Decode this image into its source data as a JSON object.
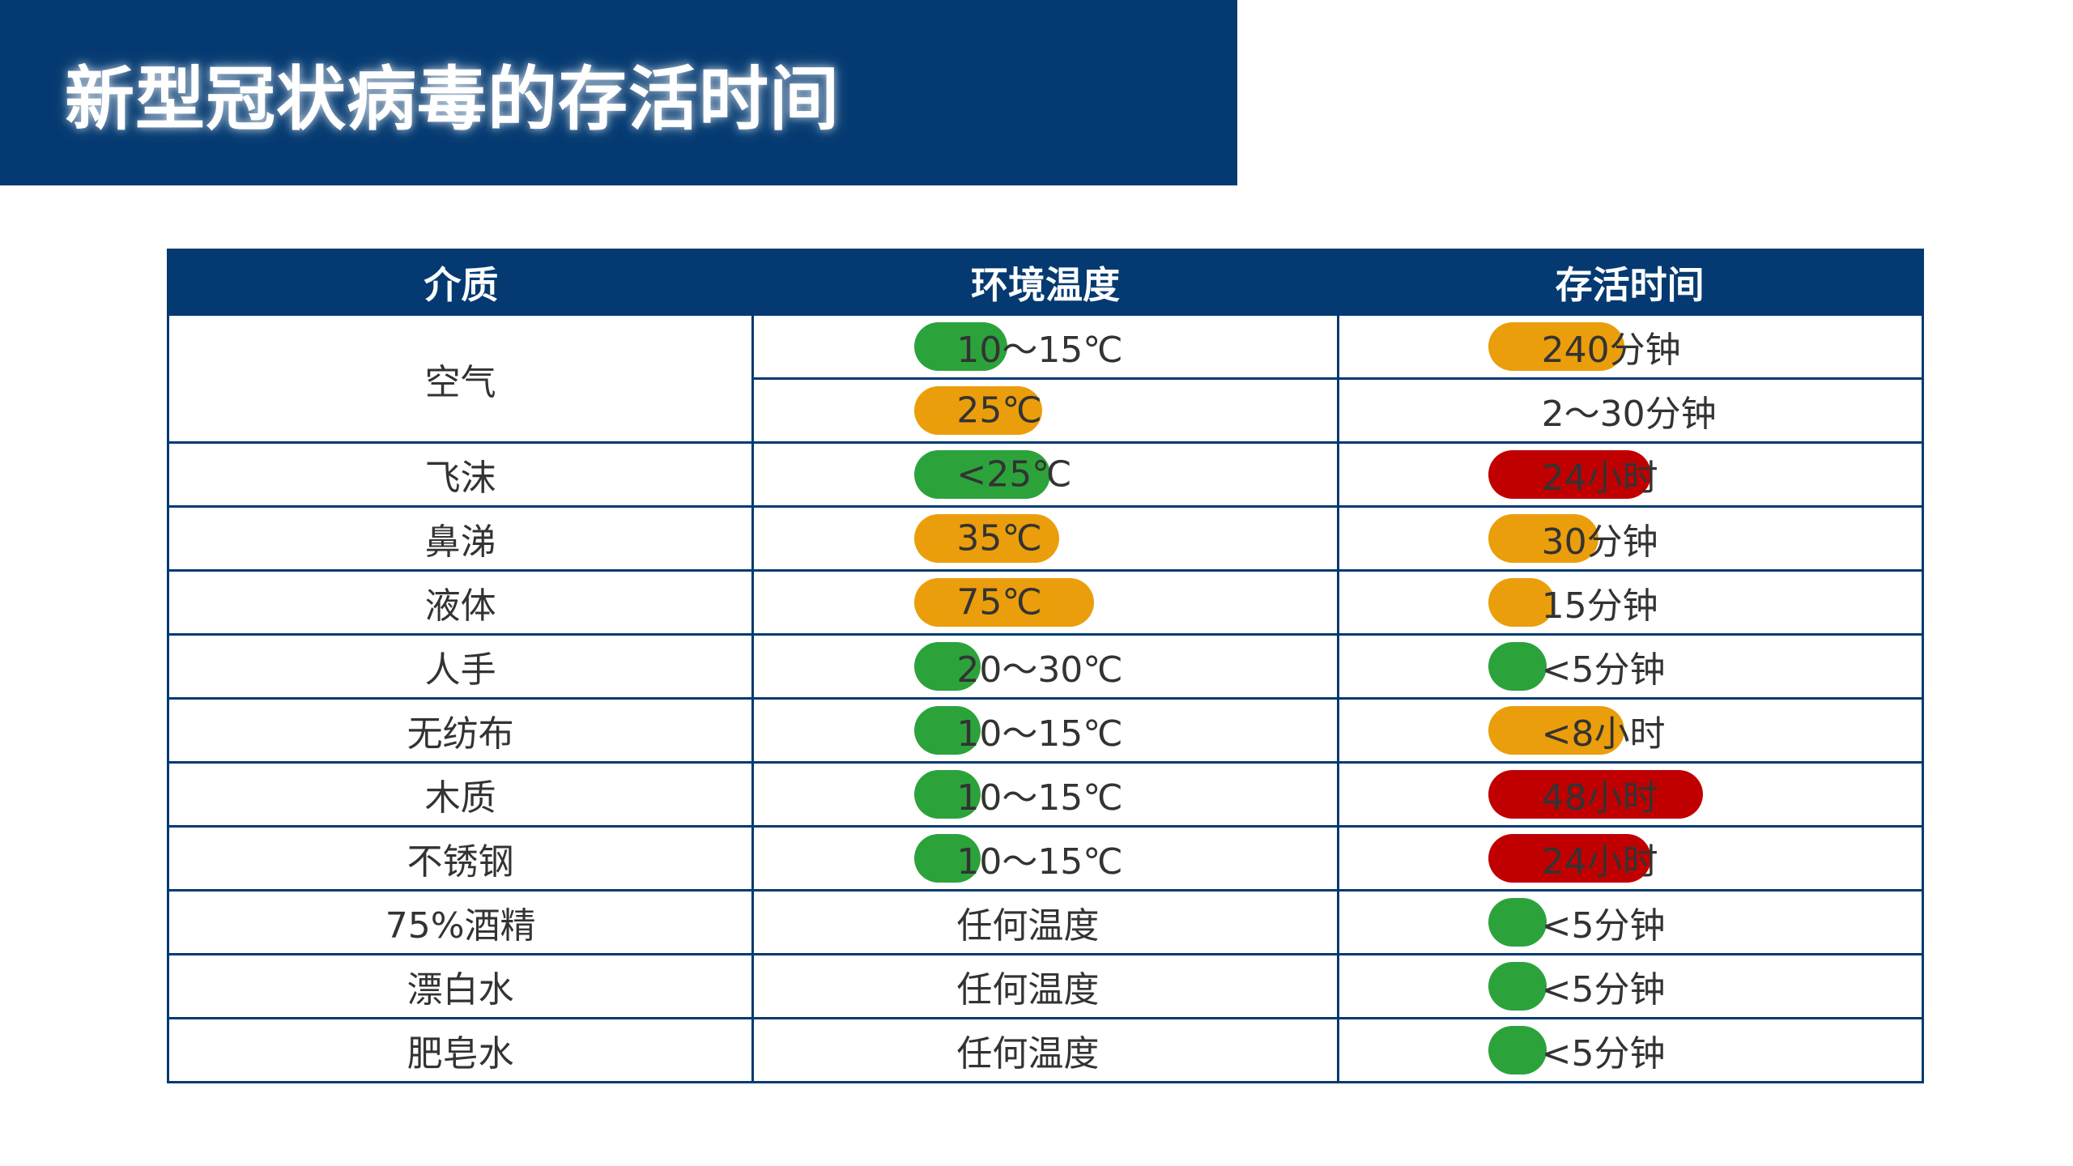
{
  "title": "新型冠状病毒的存活时间",
  "colors": {
    "banner": "#043a71",
    "green": "#2ba33a",
    "orange": "#eb9e0b",
    "red": "#c00000"
  },
  "headers": [
    "介质",
    "环境温度",
    "存活时间"
  ],
  "rows": [
    {
      "medium": "空气",
      "temp": "10～15℃",
      "temp_status": "green",
      "temp_level": 0.3,
      "time": "240分钟",
      "time_status": "orange",
      "time_level": 0.55
    },
    {
      "medium": "",
      "temp": "25℃",
      "temp_status": "orange",
      "temp_level": 0.5,
      "time": "2～30分钟",
      "time_status": "none",
      "time_level": 0
    },
    {
      "medium": "飞沫",
      "temp": "<25℃",
      "temp_status": "green",
      "temp_level": 0.55,
      "time": "24小时",
      "time_status": "red",
      "time_level": 0.7
    },
    {
      "medium": "鼻涕",
      "temp": "35℃",
      "temp_status": "orange",
      "temp_level": 0.6,
      "time": "30分钟",
      "time_status": "orange",
      "time_level": 0.4
    },
    {
      "medium": "液体",
      "temp": "75℃",
      "temp_status": "orange",
      "temp_level": 0.8,
      "time": "15分钟",
      "time_status": "orange",
      "time_level": 0.15
    },
    {
      "medium": "人手",
      "temp": "20～30℃",
      "temp_status": "green",
      "temp_level": 0.15,
      "time": "<5分钟",
      "time_status": "green",
      "time_level": 0.1
    },
    {
      "medium": "无纺布",
      "temp": "10～15℃",
      "temp_status": "green",
      "temp_level": 0.15,
      "time": "<8小时",
      "time_status": "orange",
      "time_level": 0.55
    },
    {
      "medium": "木质",
      "temp": "10～15℃",
      "temp_status": "green",
      "temp_level": 0.15,
      "time": "48小时",
      "time_status": "red",
      "time_level": 1.0
    },
    {
      "medium": "不锈钢",
      "temp": "10～15℃",
      "temp_status": "green",
      "temp_level": 0.15,
      "time": "24小时",
      "time_status": "red",
      "time_level": 0.7
    },
    {
      "medium": "75%酒精",
      "temp": "任何温度",
      "temp_status": "none",
      "temp_level": 0,
      "time": "<5分钟",
      "time_status": "green",
      "time_level": 0.1
    },
    {
      "medium": "漂白水",
      "temp": "任何温度",
      "temp_status": "none",
      "temp_level": 0,
      "time": "<5分钟",
      "time_status": "green",
      "time_level": 0.1
    },
    {
      "medium": "肥皂水",
      "temp": "任何温度",
      "temp_status": "none",
      "temp_level": 0,
      "time": "<5分钟",
      "time_status": "green",
      "time_level": 0.1
    }
  ]
}
